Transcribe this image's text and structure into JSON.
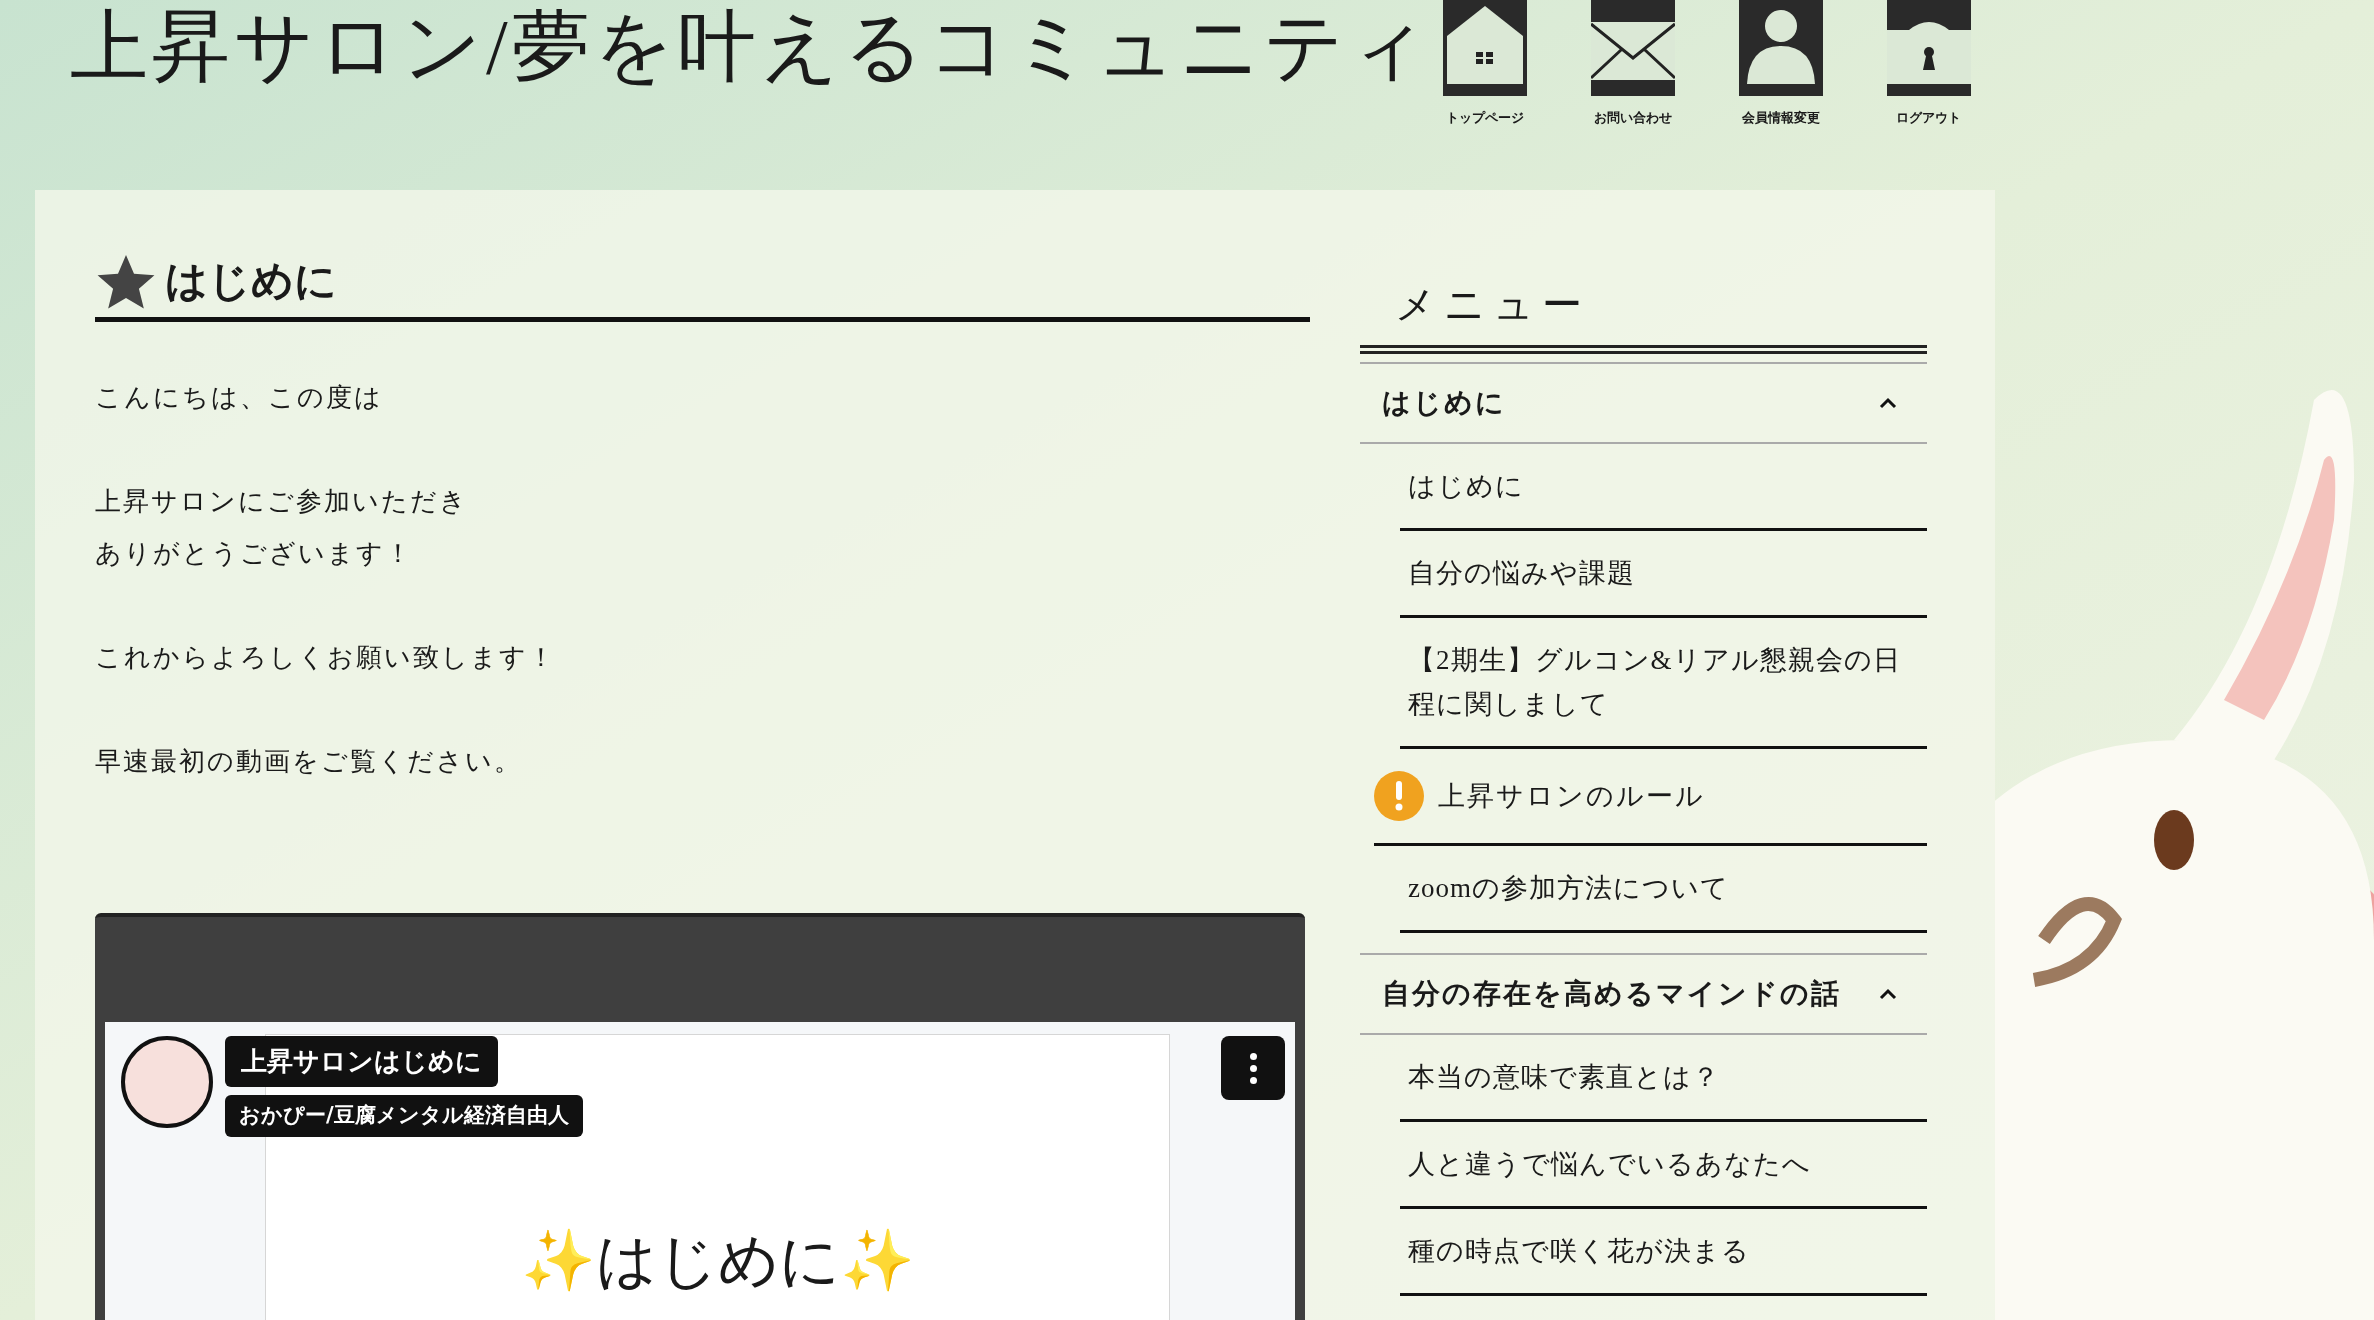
{
  "site_title": "上昇サロン/夢を叶えるコミュニティ",
  "nav": [
    {
      "kind": "home",
      "label": "トップページ"
    },
    {
      "kind": "mail",
      "label": "お問い合わせ"
    },
    {
      "kind": "person",
      "label": "会員情報変更"
    },
    {
      "kind": "lock",
      "label": "ログアウト"
    }
  ],
  "article": {
    "heading": "はじめに",
    "paragraphs": [
      [
        "こんにちは、この度は"
      ],
      [
        "上昇サロンにご参加いただき",
        "ありがとうございます！"
      ],
      [
        "これからよろしくお願い致します！"
      ],
      [
        "早速最初の動画をご覧ください。"
      ]
    ],
    "video": {
      "title": "上昇サロンはじめに",
      "channel": "おかぴー/豆腐メンタル経済自由人",
      "slide_text": "✨はじめに✨"
    }
  },
  "sidebar": {
    "title": "メニュー",
    "groups": [
      {
        "label": "はじめに",
        "expanded": true,
        "items": [
          {
            "kind": "item",
            "label": "はじめに"
          },
          {
            "kind": "item",
            "label": "自分の悩みや課題"
          },
          {
            "kind": "item",
            "label": "【2期生】グルコン&リアル懇親会の日程に関しまして"
          },
          {
            "kind": "notice",
            "label": "上昇サロンのルール"
          },
          {
            "kind": "item",
            "label": "zoomの参加方法について"
          }
        ]
      },
      {
        "label": "自分の存在を高めるマインドの話",
        "expanded": true,
        "items": [
          {
            "kind": "item",
            "label": "本当の意味で素直とは？"
          },
          {
            "kind": "item",
            "label": "人と違うで悩んでいるあなたへ"
          },
          {
            "kind": "item",
            "label": "種の時点で咲く花が決まる"
          }
        ]
      }
    ]
  }
}
